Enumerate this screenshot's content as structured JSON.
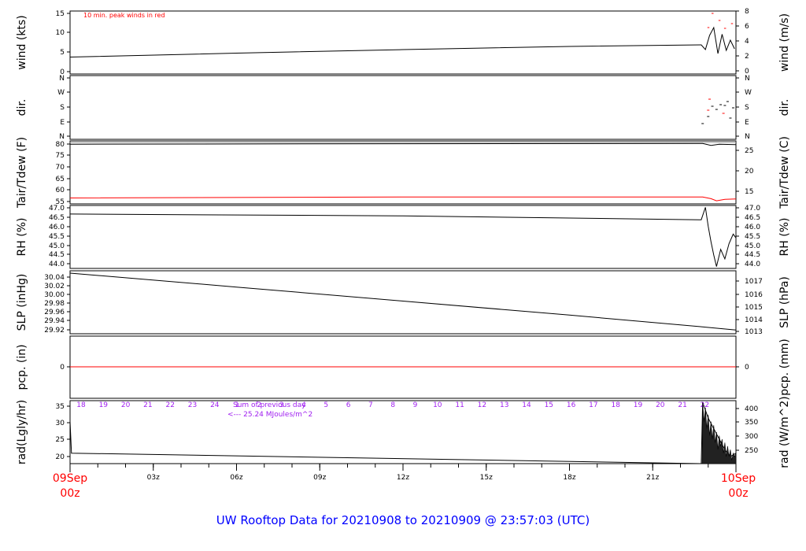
{
  "chart_data": {
    "type": "line",
    "title": "UW Rooftop Data for 20210908  to  20210909 @ 23:57:03  (UTC)",
    "time_axis": {
      "start_label": [
        "09Sep",
        "00z"
      ],
      "end_label": [
        "10Sep",
        "00z"
      ],
      "ticks": [
        "03z",
        "06z",
        "09z",
        "12z",
        "15z",
        "18z",
        "21z"
      ]
    },
    "panels": [
      {
        "id": "wind",
        "ylabel_left": "wind (kts)",
        "ylabel_right": "wind (m/s)",
        "left_ticks": [
          "0",
          "5",
          "10",
          "15"
        ],
        "right_ticks": [
          "0",
          "2",
          "4",
          "6",
          "8"
        ],
        "ylim": [
          0,
          16
        ],
        "annotation": "10 min. peak winds in red",
        "series": [
          {
            "values": [
              [
                0,
                4.3
              ],
              [
                6,
                5.3
              ],
              [
                12,
                6.2
              ],
              [
                18,
                7.0
              ],
              [
                22.75,
                7.4
              ],
              [
                22.9,
                6.2
              ],
              [
                23.05,
                9.8
              ],
              [
                23.2,
                11.8
              ],
              [
                23.35,
                5.2
              ],
              [
                23.5,
                10.1
              ],
              [
                23.65,
                6.0
              ],
              [
                23.8,
                8.6
              ],
              [
                23.95,
                6.4
              ]
            ]
          }
        ]
      },
      {
        "id": "dir",
        "ylabel_left": "dir.",
        "ylabel_right": "dir.",
        "left_ticks": [
          "N",
          "E",
          "S",
          "W",
          "N"
        ],
        "right_ticks": [
          "N",
          "E",
          "S",
          "W",
          "N"
        ],
        "ylim": [
          0,
          360
        ]
      },
      {
        "id": "temp",
        "ylabel_left": "Tair/Tdew (F)",
        "ylabel_right": "Tair/Tdew (C)",
        "left_ticks": [
          "55",
          "60",
          "65",
          "70",
          "75",
          "80"
        ],
        "right_ticks": [
          "15",
          "20",
          "25"
        ],
        "ylim": [
          54.5,
          81
        ],
        "series": [
          {
            "values": [
              [
                0,
                79.6
              ],
              [
                12,
                79.8
              ],
              [
                22.8,
                79.9
              ],
              [
                23.1,
                79.1
              ],
              [
                23.4,
                79.6
              ],
              [
                24,
                79.4
              ]
            ]
          },
          {
            "values": [
              [
                0,
                57.0
              ],
              [
                12,
                57.4
              ],
              [
                22.8,
                57.4
              ],
              [
                23.1,
                56.7
              ],
              [
                23.3,
                55.8
              ],
              [
                23.6,
                56.4
              ],
              [
                24,
                56.6
              ]
            ]
          }
        ]
      },
      {
        "id": "rh",
        "ylabel_left": "RH (%)",
        "ylabel_right": "RH (%)",
        "left_ticks": [
          "44.0",
          "44.5",
          "45.0",
          "45.5",
          "46.0",
          "46.5",
          "47.0"
        ],
        "right_ticks": [
          "44.0",
          "44.5",
          "45.0",
          "45.5",
          "46.0",
          "46.5",
          "47.0"
        ],
        "ylim": [
          43.8,
          47.1
        ],
        "series": [
          {
            "values": [
              [
                0,
                46.65
              ],
              [
                12,
                46.55
              ],
              [
                22.75,
                46.35
              ],
              [
                22.9,
                47.0
              ],
              [
                23.0,
                46.0
              ],
              [
                23.1,
                45.2
              ],
              [
                23.2,
                44.5
              ],
              [
                23.3,
                43.9
              ],
              [
                23.45,
                44.8
              ],
              [
                23.6,
                44.3
              ],
              [
                23.75,
                45.1
              ],
              [
                23.9,
                45.6
              ],
              [
                24,
                45.4
              ]
            ]
          }
        ]
      },
      {
        "id": "slp",
        "ylabel_left": "SLP (inHg)",
        "ylabel_right": "SLP (hPa)",
        "left_ticks": [
          "29.92",
          "29.94",
          "29.96",
          "29.98",
          "30.00",
          "30.02",
          "30.04"
        ],
        "right_ticks": [
          "1013",
          "1014",
          "1015",
          "1016",
          "1017"
        ],
        "ylim": [
          29.915,
          30.05
        ],
        "series": [
          {
            "values": [
              [
                0,
                30.045
              ],
              [
                6,
                30.015
              ],
              [
                12,
                29.985
              ],
              [
                18,
                29.955
              ],
              [
                22.75,
                29.93
              ],
              [
                24,
                29.923
              ]
            ]
          }
        ]
      },
      {
        "id": "pcp",
        "ylabel_left": "pcp. (in)",
        "ylabel_right": "pcp. (mm)",
        "left_ticks": [
          "0"
        ],
        "right_ticks": [
          "0"
        ],
        "series": [
          {
            "color": "#ff0000",
            "values": [
              [
                0,
                0
              ],
              [
                24,
                0
              ]
            ]
          }
        ]
      },
      {
        "id": "rad",
        "ylabel_left": "rad(Lgly/hr)",
        "ylabel_right": "rad (W/m^2)",
        "left_ticks": [
          "20",
          "25",
          "30",
          "35"
        ],
        "right_ticks": [
          "250",
          "300",
          "350",
          "400"
        ],
        "hour_labels": [
          "18",
          "19",
          "20",
          "21",
          "22",
          "23",
          "24",
          "1",
          "2",
          "3",
          "4",
          "5",
          "6",
          "7",
          "8",
          "9",
          "10",
          "11",
          "12",
          "13",
          "14",
          "15",
          "16",
          "17",
          "18",
          "19",
          "20",
          "21",
          "22"
        ],
        "annotation_1": "Sum of previous day",
        "annotation_2": "<--- 25.24 MJoules/m^2",
        "ylim": [
          18,
          36
        ],
        "series": [
          {
            "values": [
              [
                0,
                30
              ],
              [
                0.05,
                21
              ],
              [
                22.75,
                18
              ],
              [
                22.8,
                35.5
              ],
              [
                23.0,
                31
              ],
              [
                23.2,
                28
              ],
              [
                23.4,
                25
              ],
              [
                23.6,
                22
              ],
              [
                23.8,
                20
              ],
              [
                24,
                21
              ]
            ]
          }
        ]
      }
    ]
  }
}
